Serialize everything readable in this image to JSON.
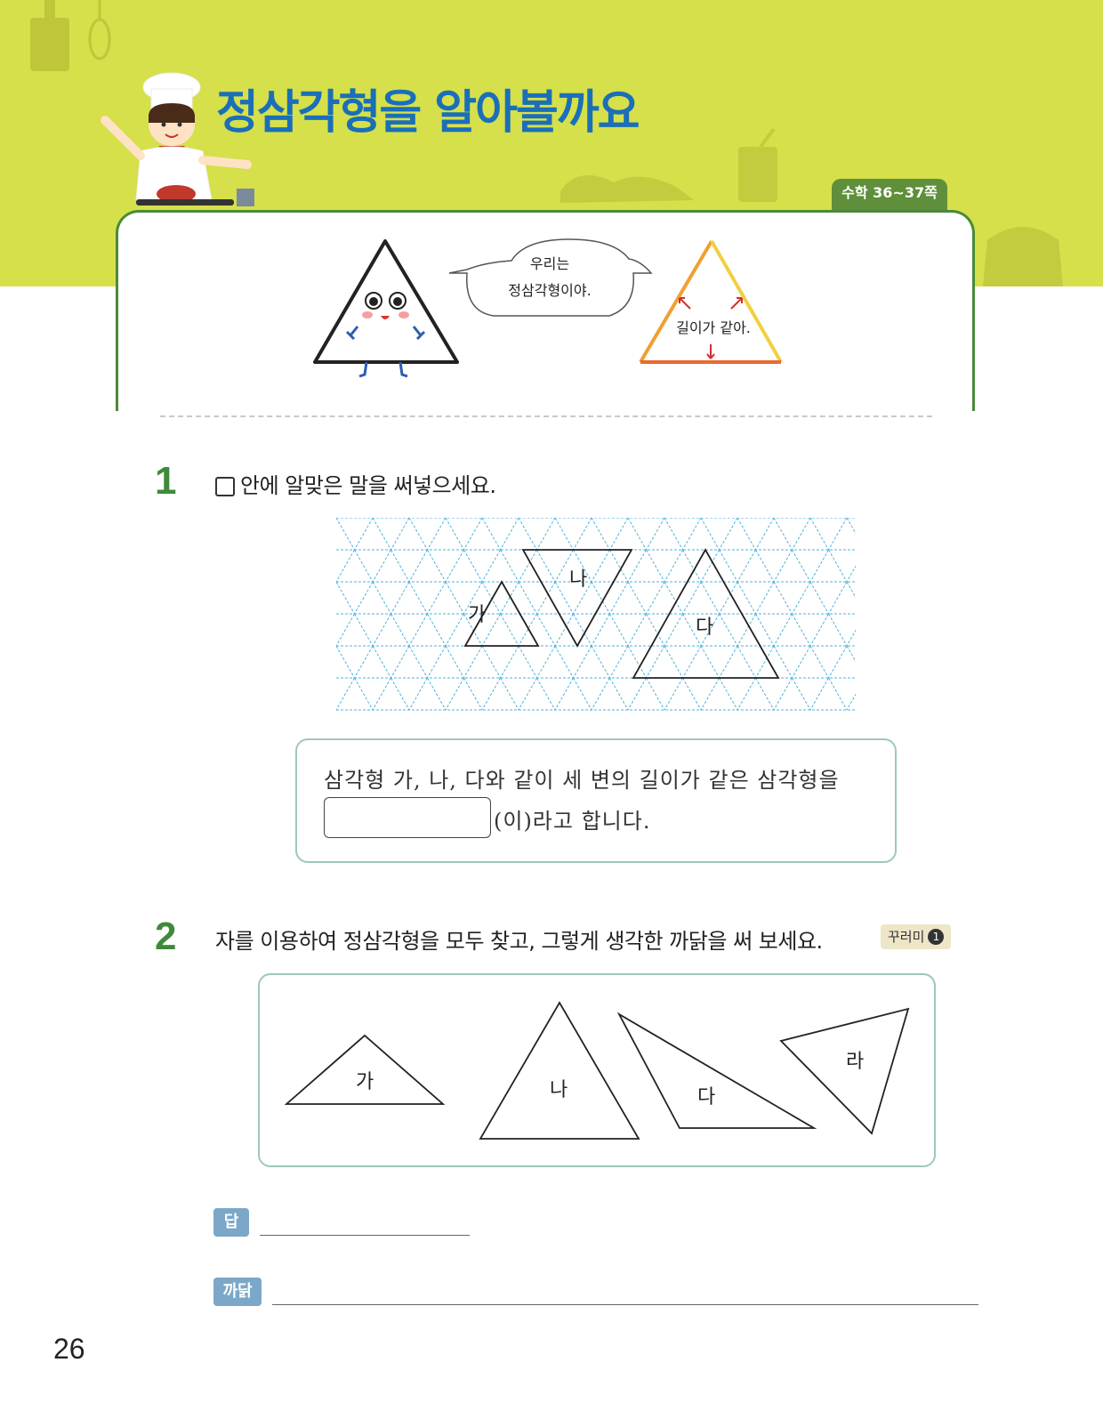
{
  "header": {
    "title": "정삼각형을 알아볼까요",
    "reference_tab": "수학 36~37쪽"
  },
  "intro": {
    "speech_bubble": [
      "우리는",
      "정삼각형이야."
    ],
    "equal_sides_note": "길이가 같아."
  },
  "question1": {
    "number": "1",
    "instruction": "안에 알맞은 말을 써넣으세요.",
    "grid_labels": [
      "가",
      "나",
      "다"
    ],
    "sentence_line1": "삼각형 가, 나, 다와 같이 세 변의 길이가 같은 삼각형을",
    "sentence_line2_suffix": "(이)라고 합니다."
  },
  "question2": {
    "number": "2",
    "instruction": "자를 이용하여 정삼각형을 모두 찾고, 그렇게 생각한 까닭을 써 보세요.",
    "hint_label": "꾸러미",
    "hint_number": "1",
    "triangle_labels": [
      "가",
      "나",
      "다",
      "라"
    ],
    "answer_label": "답",
    "reason_label": "까닭"
  },
  "footer": {
    "page_number": "26"
  },
  "colors": {
    "header_band": "#d5e04a",
    "title": "#1a6fb8",
    "accent_green": "#4a8a3a",
    "question_number": "#3f8a3a",
    "grid_line": "#4db3e0",
    "box_border": "#9ec9b5",
    "label_chip": "#7ba7c8"
  }
}
